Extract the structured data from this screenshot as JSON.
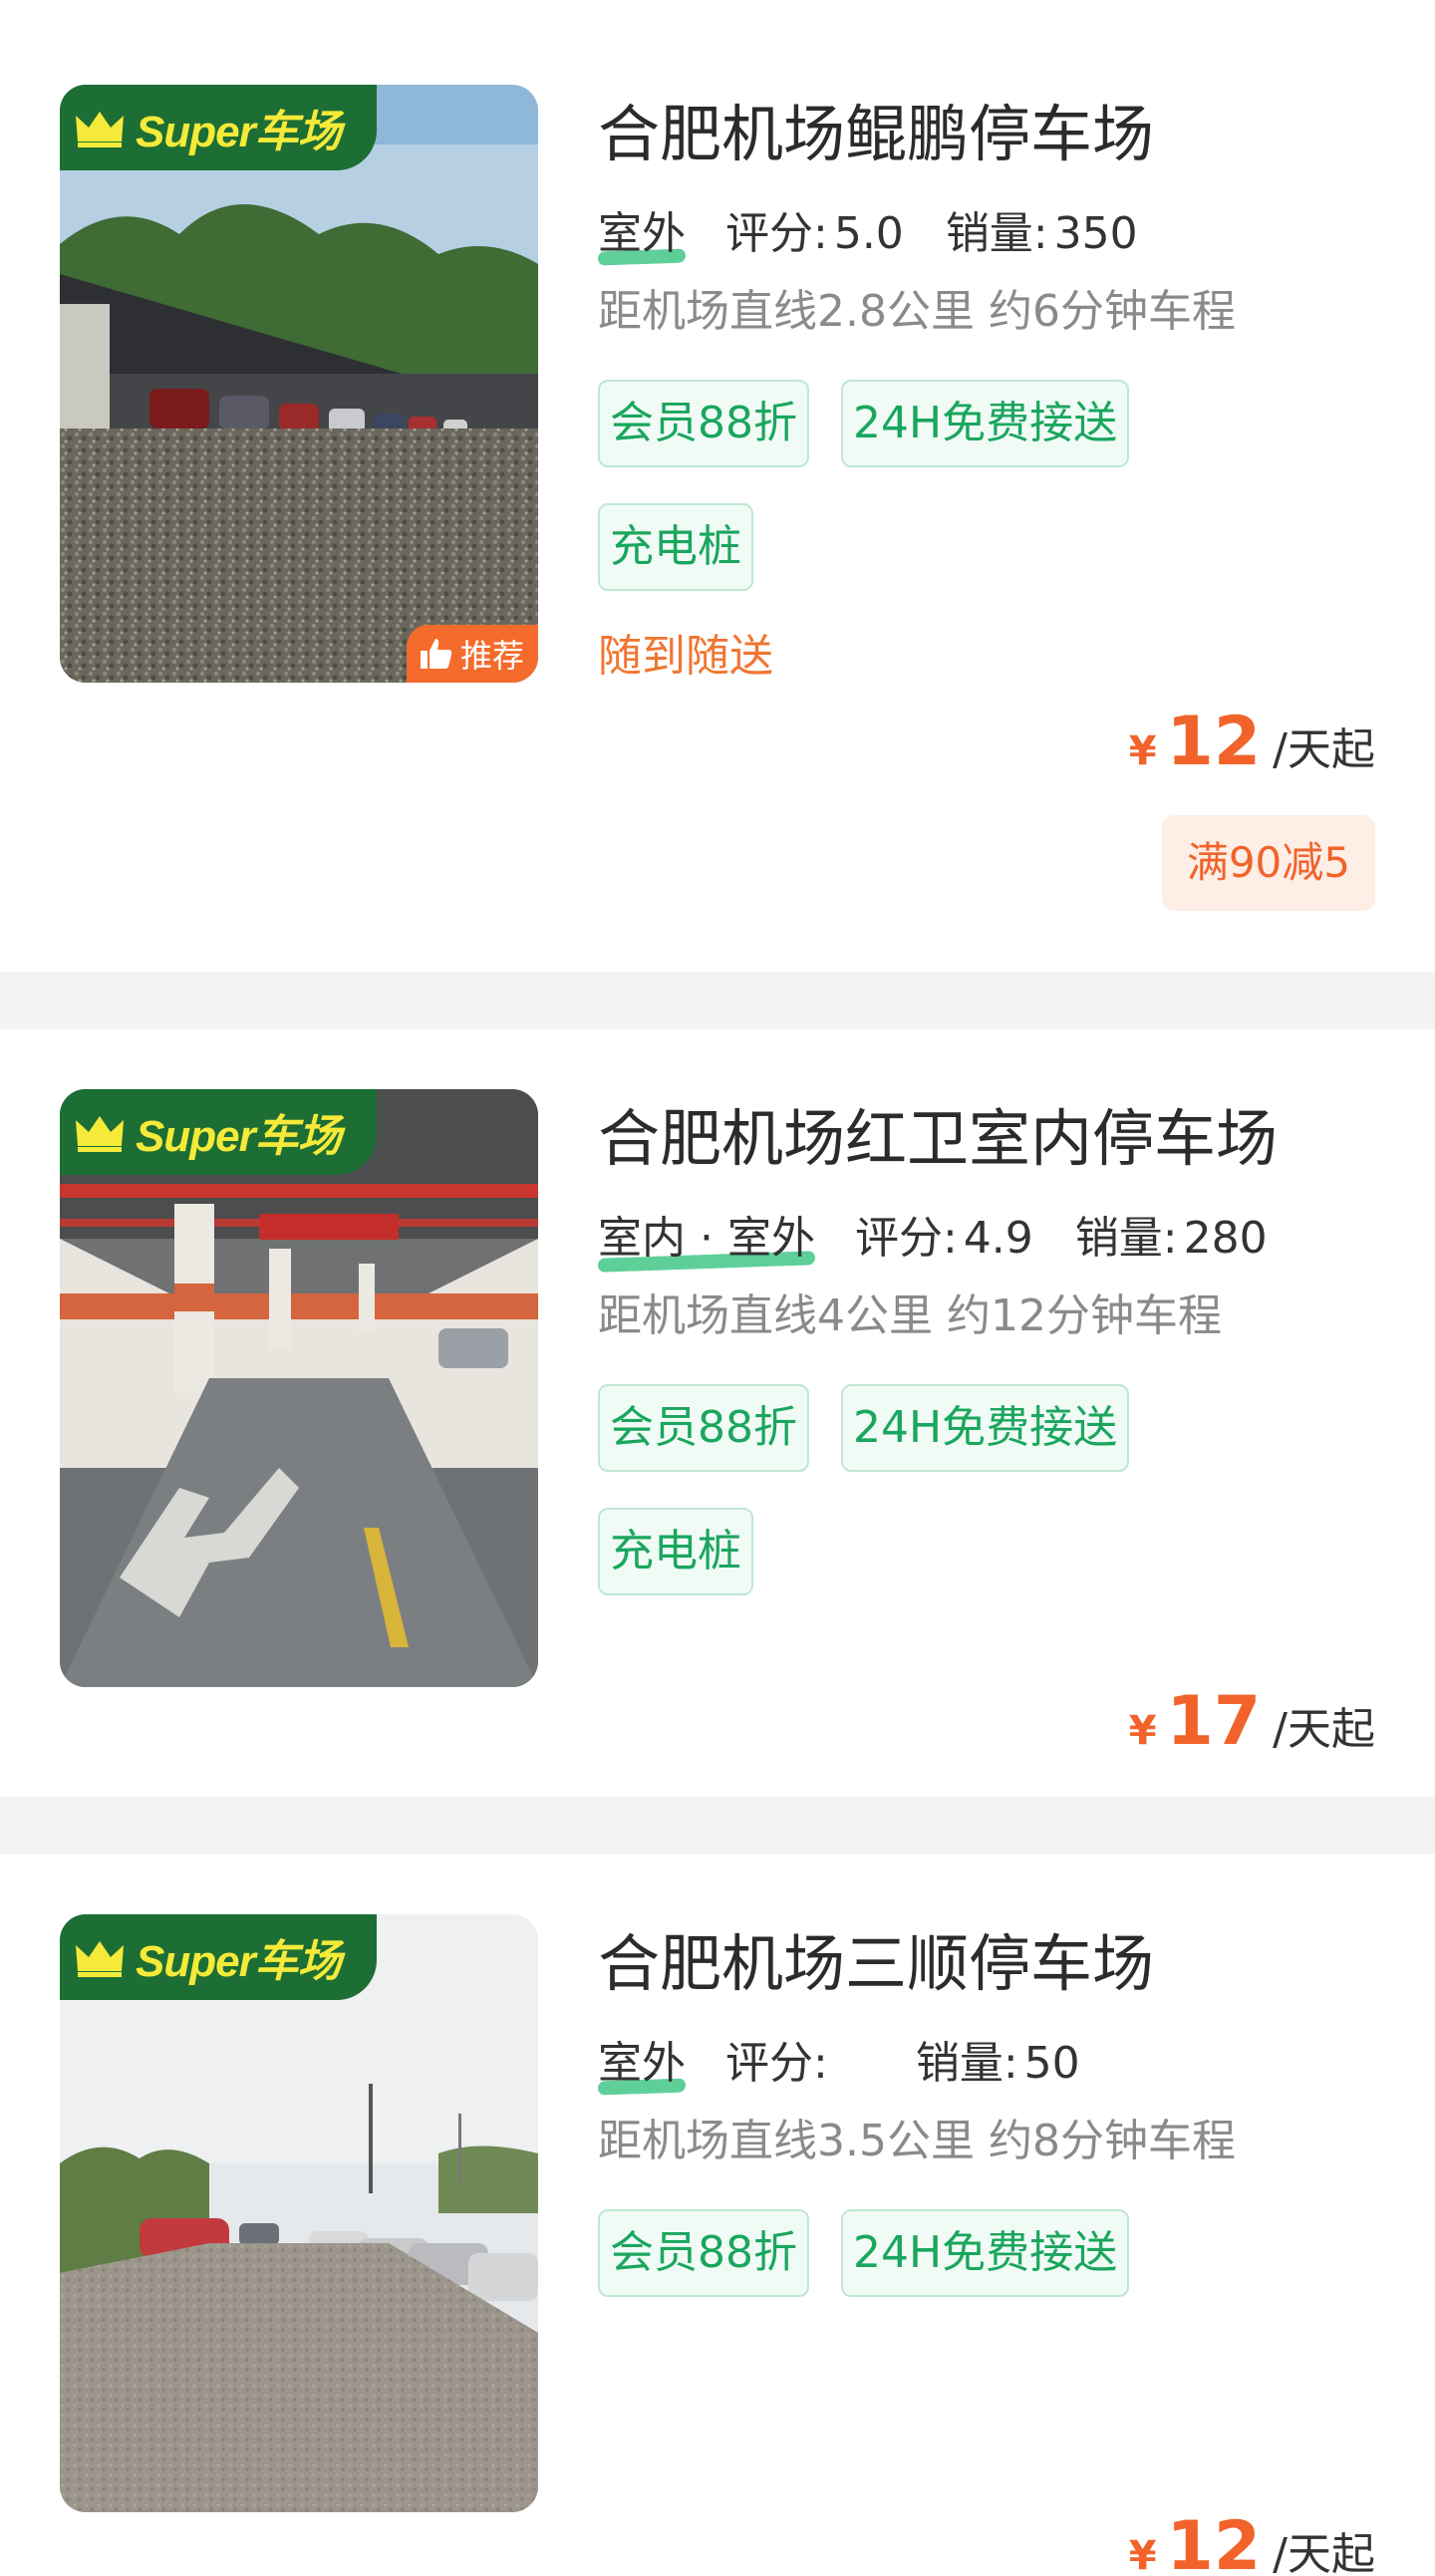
{
  "colors": {
    "accent_orange": "#f1632b",
    "tag_green": "#1aa65e",
    "badge_green": "#1d6e34",
    "badge_yellow": "#f5ea3a"
  },
  "lots": [
    {
      "badge": "Super车场",
      "recommend": "推荐",
      "name": "合肥机场鲲鹏停车场",
      "type": "室外",
      "rating_label": "评分:",
      "rating": "5.0",
      "sales_label": "销量:",
      "sales": "350",
      "distance": "距机场直线2.8公里 约6分钟车程",
      "tags": [
        "会员88折",
        "24H免费接送",
        "充电桩"
      ],
      "service": "随到随送",
      "currency": "¥",
      "price": "12",
      "price_unit": "/天起",
      "promo": "满90减5"
    },
    {
      "badge": "Super车场",
      "name": "合肥机场红卫室内停车场",
      "type": "室内 · 室外",
      "rating_label": "评分:",
      "rating": "4.9",
      "sales_label": "销量:",
      "sales": "280",
      "distance": "距机场直线4公里 约12分钟车程",
      "tags": [
        "会员88折",
        "24H免费接送",
        "充电桩"
      ],
      "currency": "¥",
      "price": "17",
      "price_unit": "/天起"
    },
    {
      "badge": "Super车场",
      "name": "合肥机场三顺停车场",
      "type": "室外",
      "rating_label": "评分:",
      "rating": "",
      "sales_label": "销量:",
      "sales": "50",
      "distance": "距机场直线3.5公里 约8分钟车程",
      "tags": [
        "会员88折",
        "24H免费接送"
      ],
      "currency": "¥",
      "price": "12",
      "price_unit": "/天起"
    }
  ]
}
